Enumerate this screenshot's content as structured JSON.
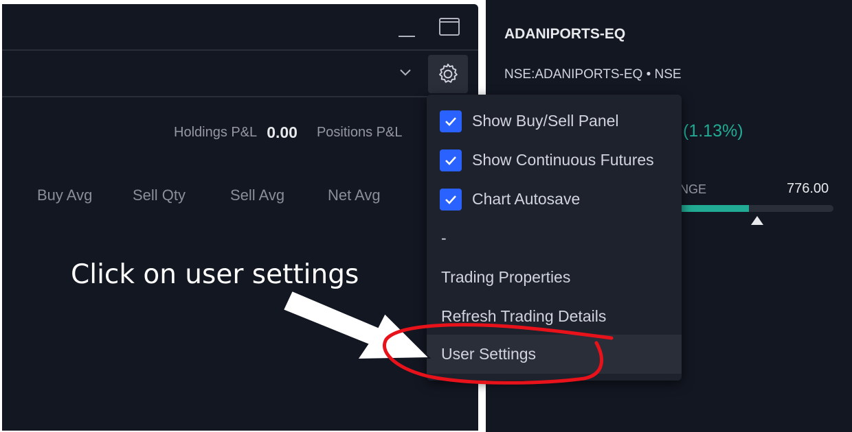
{
  "left_panel": {
    "holdings_pnl_label": "Holdings P&L",
    "holdings_pnl_value": "0.00",
    "positions_pnl_label": "Positions P&L",
    "columns": [
      "Buy Avg",
      "Sell Qty",
      "Sell Avg",
      "Net Avg"
    ]
  },
  "right_panel": {
    "symbol_name": "ADANIPORTS-EQ",
    "symbol_exchange": "NSE:ADANIPORTS-EQ • NSE",
    "change_pct": "(1.13%)",
    "range_label": "ANGE",
    "range_high": "776.00",
    "range_fill_fraction": 0.48
  },
  "menu": {
    "items": [
      {
        "label": "Show Buy/Sell Panel",
        "checked": true
      },
      {
        "label": "Show Continuous Futures",
        "checked": true
      },
      {
        "label": "Chart Autosave",
        "checked": true
      },
      {
        "label": "-",
        "checked": false
      },
      {
        "label": "Trading Properties",
        "checked": false
      },
      {
        "label": "Refresh Trading Details",
        "checked": false
      },
      {
        "label": "User Settings",
        "checked": false,
        "highlighted": true
      }
    ]
  },
  "annotation": {
    "text": "Click on user settings",
    "color": "#e8121b"
  },
  "colors": {
    "background": "#131722",
    "menu_background": "#1e222d",
    "checkbox": "#2962ff",
    "positive": "#22ab94"
  },
  "icons": [
    "minimize-icon",
    "maximize-icon",
    "chevron-down-icon",
    "gear-icon",
    "checkmark-icon",
    "triangle-marker-icon"
  ]
}
